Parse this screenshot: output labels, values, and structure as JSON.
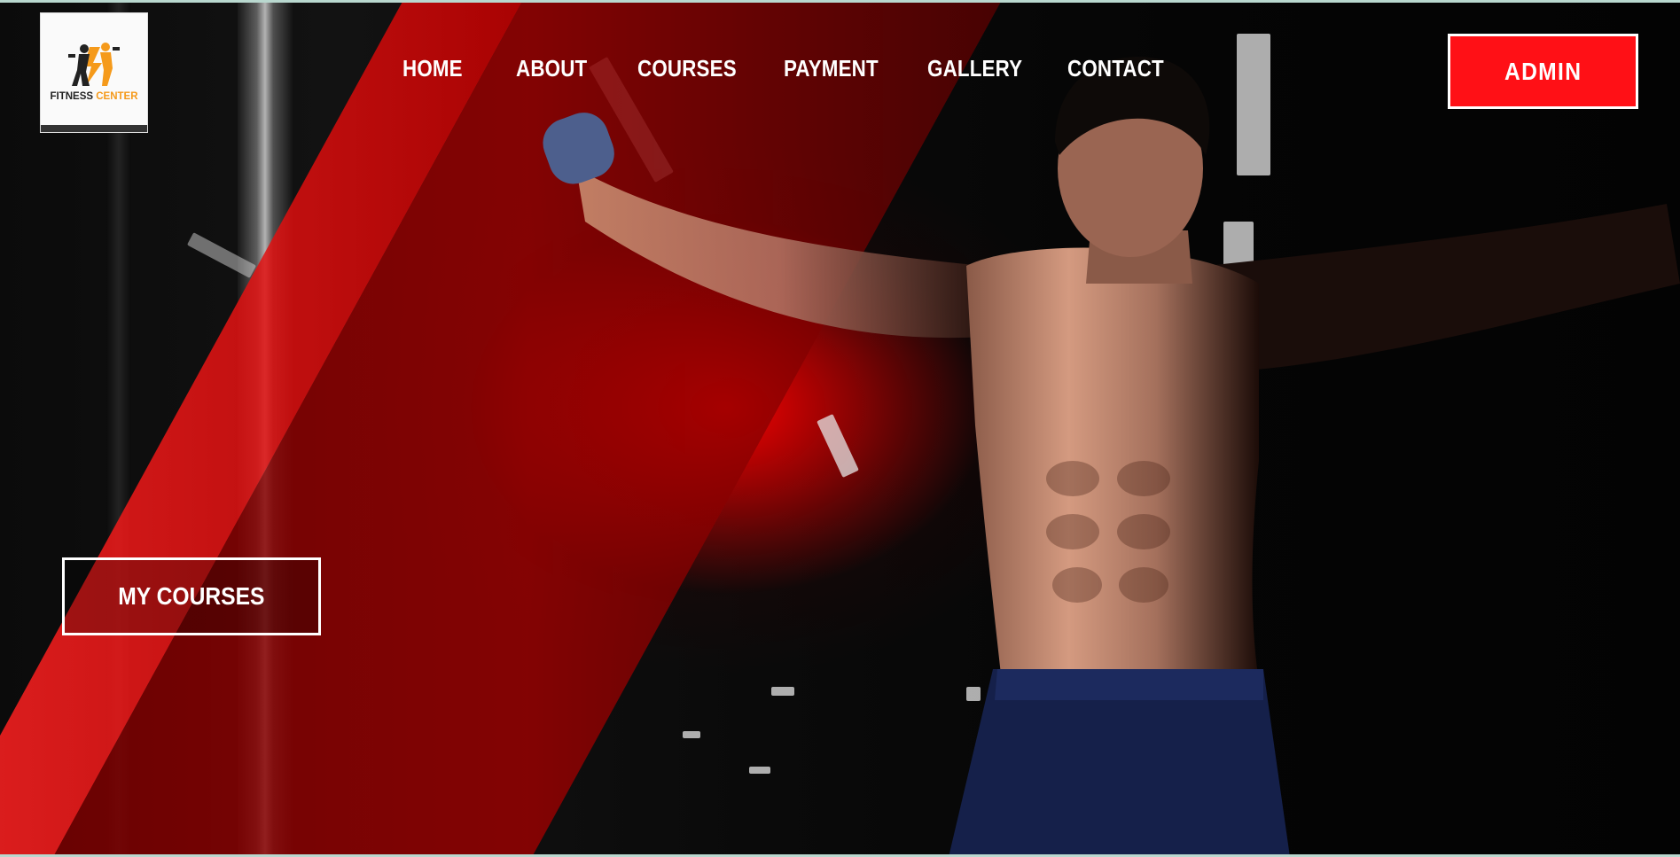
{
  "brand": {
    "name_part1": "FITNESS",
    "name_part2": "CENTER",
    "accent_color": "#f59a1b",
    "logo_icon": "fitness-figures-logo"
  },
  "nav": {
    "items": [
      {
        "label": "HOME"
      },
      {
        "label": "ABOUT"
      },
      {
        "label": "COURSES"
      },
      {
        "label": "PAYMENT"
      },
      {
        "label": "GALLERY"
      },
      {
        "label": "CONTACT"
      }
    ]
  },
  "header": {
    "admin_label": "ADMIN",
    "admin_color": "#ff1016"
  },
  "hero": {
    "cta_label": "MY COURSES",
    "band_color": "#e10b0b"
  }
}
